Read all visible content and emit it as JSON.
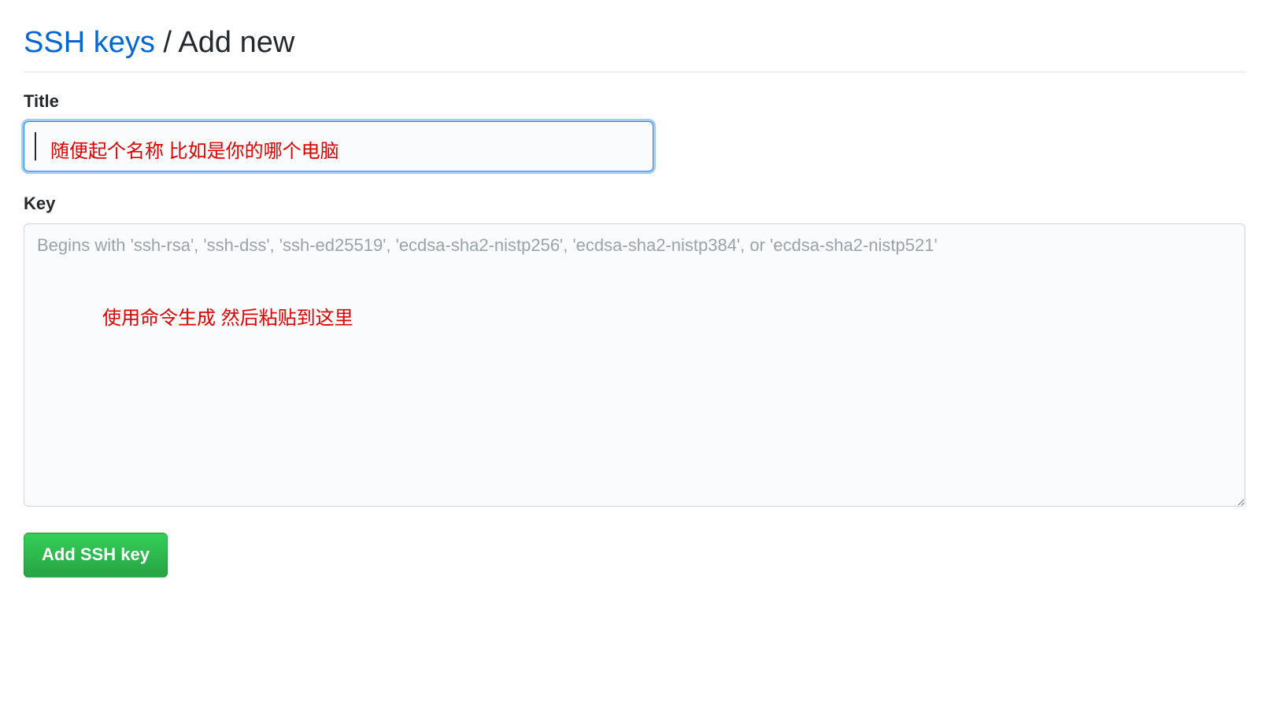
{
  "header": {
    "link_text": "SSH keys",
    "separator": " / ",
    "current": "Add new"
  },
  "form": {
    "title_label": "Title",
    "title_value": "",
    "title_annotation": "随便起个名称  比如是你的哪个电脑",
    "key_label": "Key",
    "key_placeholder": "Begins with 'ssh-rsa', 'ssh-dss', 'ssh-ed25519', 'ecdsa-sha2-nistp256', 'ecdsa-sha2-nistp384', or 'ecdsa-sha2-nistp521'",
    "key_value": "",
    "key_annotation": "使用命令生成   然后粘贴到这里",
    "submit_label": "Add SSH key"
  }
}
